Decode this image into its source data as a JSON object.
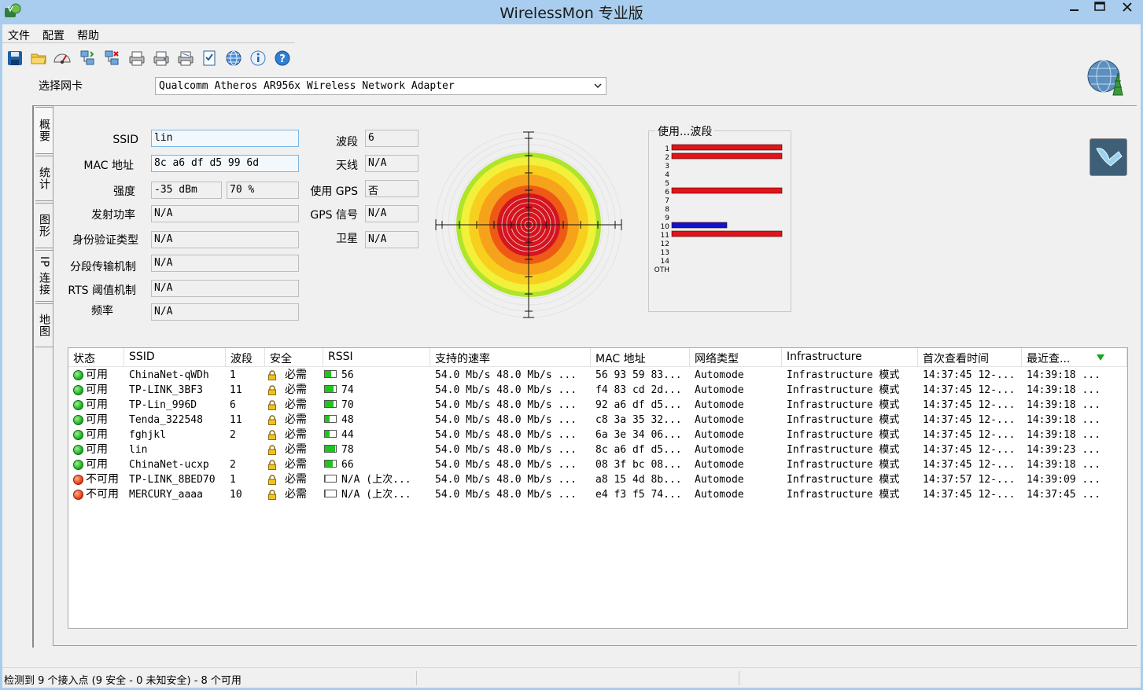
{
  "window": {
    "title": "WirelessMon 专业版"
  },
  "menu": [
    "文件",
    "配置",
    "帮助"
  ],
  "toolbar": [
    "save-icon",
    "open-folder-icon",
    "gauge-icon",
    "network-connect-icon",
    "network-disconnect-icon",
    "printer-icon",
    "printer-icon",
    "printer-icon",
    "checklist-icon",
    "globe-icon",
    "info-icon",
    "help-icon"
  ],
  "adapter": {
    "label": "选择网卡",
    "value": "Qualcomm Atheros AR956x Wireless Network Adapter"
  },
  "tabs": [
    "概要",
    "统计",
    "图形",
    "IP 连接",
    "地图"
  ],
  "summary": {
    "ssid_label": "SSID",
    "ssid": "lin",
    "mac_label": "MAC 地址",
    "mac": "8c a6 df d5 99 6d",
    "strength_label": "强度",
    "strength_dbm": "-35 dBm",
    "strength_pct": "70 %",
    "txpower_label": "发射功率",
    "txpower": "N/A",
    "auth_label": "身份验证类型",
    "auth": "N/A",
    "frag_label": "分段传输机制",
    "frag": "N/A",
    "rts_label": "RTS 阈值机制",
    "rts": "N/A",
    "freq_label": "频率",
    "freq": "N/A",
    "channel_label": "波段",
    "channel": "6",
    "antenna_label": "天线",
    "antenna": "N/A",
    "gps_label": "使用 GPS",
    "gps": "否",
    "gps_signal_label": "GPS 信号",
    "gps_signal": "N/A",
    "satellite_label": "卫星",
    "satellite": "N/A"
  },
  "band_usage": {
    "title": "使用...波段",
    "labels": [
      "1",
      "2",
      "3",
      "4",
      "5",
      "6",
      "7",
      "8",
      "9",
      "10",
      "11",
      "12",
      "13",
      "14",
      "OTH"
    ],
    "bars": [
      {
        "channel": "1",
        "color": "#e0141b",
        "level": 1.0
      },
      {
        "channel": "2",
        "color": "#e0141b",
        "level": 1.0
      },
      {
        "channel": "6",
        "color": "#e0141b",
        "level": 1.0
      },
      {
        "channel": "10",
        "color": "#1313c8",
        "level": 0.5
      },
      {
        "channel": "11",
        "color": "#e0141b",
        "level": 1.0
      }
    ]
  },
  "table": {
    "columns": [
      "状态",
      "SSID",
      "波段",
      "安全",
      "RSSI",
      "支持的速率",
      "MAC 地址",
      "网络类型",
      "Infrastructure",
      "首次查看时间",
      "最近查..."
    ],
    "rows": [
      {
        "ok": true,
        "status": "可用",
        "ssid": "ChinaNet-qWDh",
        "channel": "1",
        "security": "必需",
        "rssi": "56",
        "signal": 0.6,
        "rates": "54.0 Mb/s   48.0 Mb/s ...",
        "mac": "56 93 59 83...",
        "nettype": "Automode",
        "infra": "Infrastructure 模式",
        "first": "14:37:45 12-...",
        "last": "14:39:18 ..."
      },
      {
        "ok": true,
        "status": "可用",
        "ssid": "TP-LINK_3BF3",
        "channel": "11",
        "security": "必需",
        "rssi": "74",
        "signal": 0.8,
        "rates": "54.0 Mb/s   48.0 Mb/s ...",
        "mac": "f4 83 cd 2d...",
        "nettype": "Automode",
        "infra": "Infrastructure 模式",
        "first": "14:37:45 12-...",
        "last": "14:39:18 ..."
      },
      {
        "ok": true,
        "status": "可用",
        "ssid": "TP-Lin_996D",
        "channel": "6",
        "security": "必需",
        "rssi": "70",
        "signal": 0.8,
        "rates": "54.0 Mb/s   48.0 Mb/s ...",
        "mac": "92 a6 df d5...",
        "nettype": "Automode",
        "infra": "Infrastructure 模式",
        "first": "14:37:45 12-...",
        "last": "14:39:18 ..."
      },
      {
        "ok": true,
        "status": "可用",
        "ssid": "Tenda_322548",
        "channel": "11",
        "security": "必需",
        "rssi": "48",
        "signal": 0.4,
        "rates": "54.0 Mb/s   48.0 Mb/s ...",
        "mac": "c8 3a 35 32...",
        "nettype": "Automode",
        "infra": "Infrastructure 模式",
        "first": "14:37:45 12-...",
        "last": "14:39:18 ..."
      },
      {
        "ok": true,
        "status": "可用",
        "ssid": "fghjkl",
        "channel": "2",
        "security": "必需",
        "rssi": "44",
        "signal": 0.4,
        "rates": "54.0 Mb/s   48.0 Mb/s ...",
        "mac": "6a 3e 34 06...",
        "nettype": "Automode",
        "infra": "Infrastructure 模式",
        "first": "14:37:45 12-...",
        "last": "14:39:18 ..."
      },
      {
        "ok": true,
        "status": "可用",
        "ssid": "lin",
        "channel": "",
        "security": "必需",
        "rssi": "78",
        "signal": 0.9,
        "rates": "54.0 Mb/s   48.0 Mb/s ...",
        "mac": "8c a6 df d5...",
        "nettype": "Automode",
        "infra": "Infrastructure 模式",
        "first": "14:37:45 12-...",
        "last": "14:39:23 ..."
      },
      {
        "ok": true,
        "status": "可用",
        "ssid": "ChinaNet-ucxp",
        "channel": "2",
        "security": "必需",
        "rssi": "66",
        "signal": 0.7,
        "rates": "54.0 Mb/s   48.0 Mb/s ...",
        "mac": "08 3f bc 08...",
        "nettype": "Automode",
        "infra": "Infrastructure 模式",
        "first": "14:37:45 12-...",
        "last": "14:39:18 ..."
      },
      {
        "ok": false,
        "status": "不可用",
        "ssid": "TP-LINK_8BED70",
        "channel": "1",
        "security": "必需",
        "rssi": "N/A (上次...",
        "signal": 0.1,
        "rates": "54.0 Mb/s   48.0 Mb/s ...",
        "mac": "a8 15 4d 8b...",
        "nettype": "Automode",
        "infra": "Infrastructure 模式",
        "first": "14:37:57 12-...",
        "last": "14:39:09 ..."
      },
      {
        "ok": false,
        "status": "不可用",
        "ssid": "MERCURY_aaaa",
        "channel": "10",
        "security": "必需",
        "rssi": "N/A (上次...",
        "signal": 0.1,
        "rates": "54.0 Mb/s   48.0 Mb/s ...",
        "mac": "e4 f3 f5 74...",
        "nettype": "Automode",
        "infra": "Infrastructure 模式",
        "first": "14:37:45 12-...",
        "last": "14:37:45 ..."
      }
    ]
  },
  "status": {
    "text": "检测到 9 个接入点 (9 安全 - 0 未知安全) - 8 个可用"
  }
}
